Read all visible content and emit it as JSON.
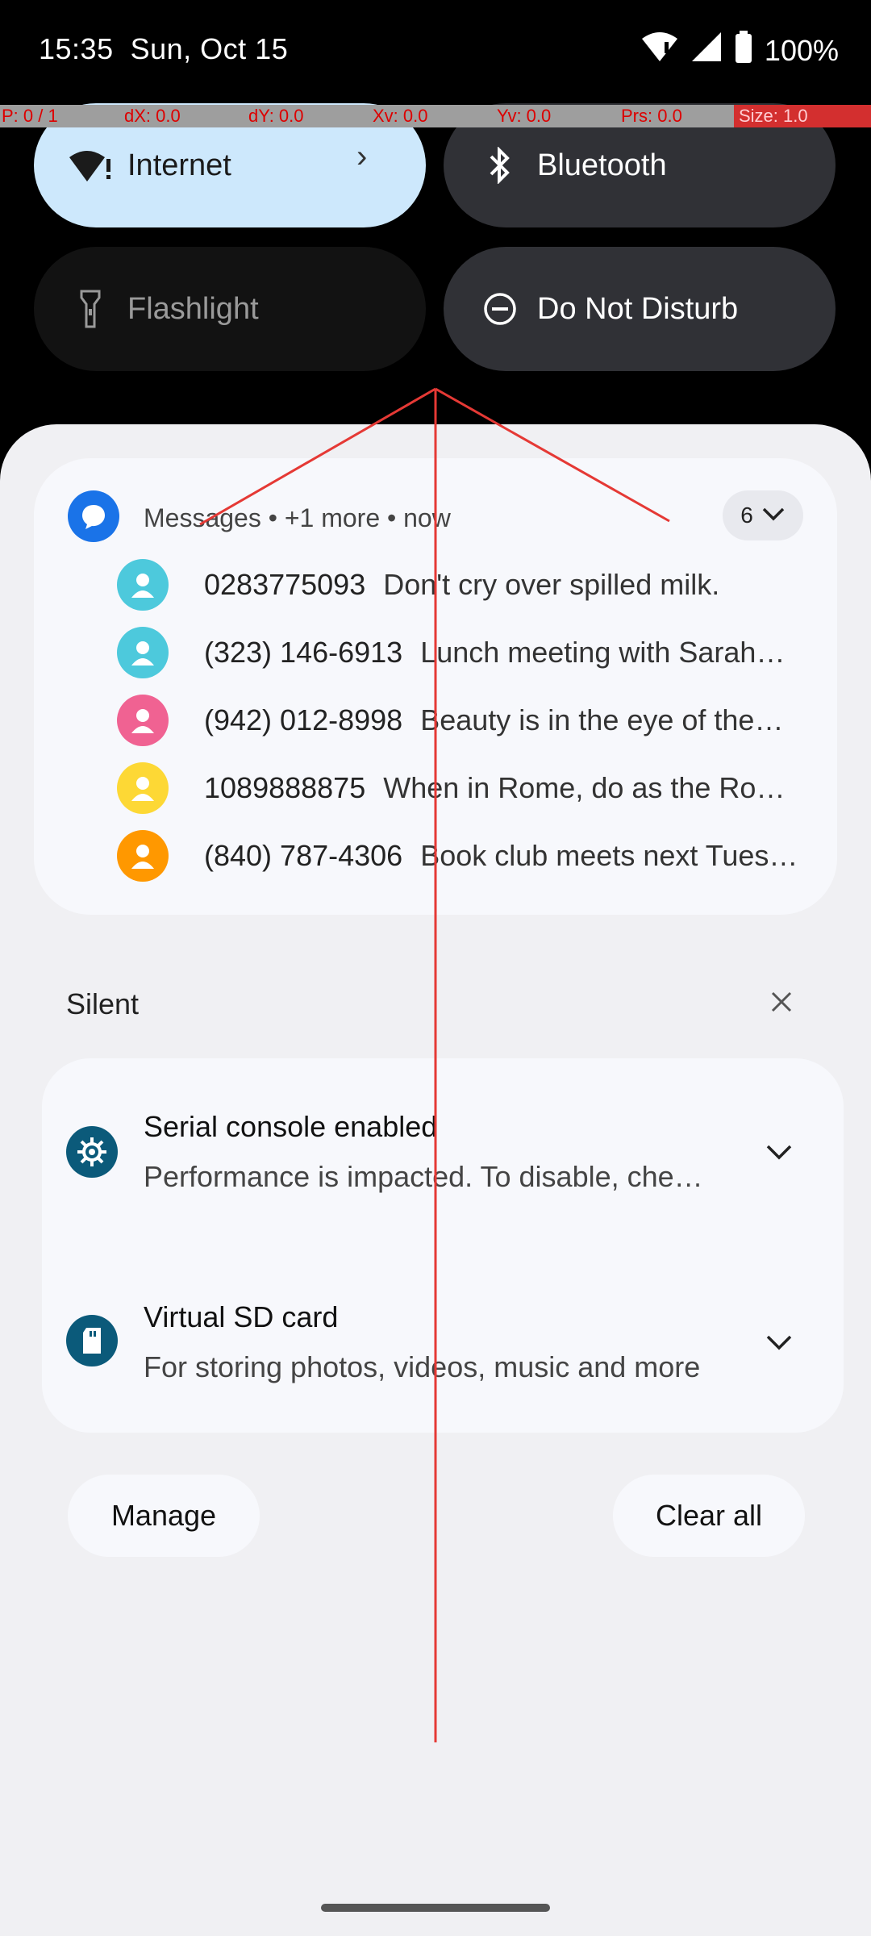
{
  "status": {
    "time": "15:35",
    "date": "Sun, Oct 15",
    "battery": "100%"
  },
  "debug": {
    "p": "P: 0 / 1",
    "dx": "dX: 0.0",
    "dy": "dY: 0.0",
    "xv": "Xv: 0.0",
    "yv": "Yv: 0.0",
    "prs": "Prs: 0.0",
    "size": "Size: 1.0"
  },
  "tiles": {
    "internet": "Internet",
    "bluetooth": "Bluetooth",
    "flashlight": "Flashlight",
    "dnd": "Do Not Disturb"
  },
  "messages": {
    "header": "Messages • +1 more • now",
    "count": "6",
    "rows": [
      {
        "number": "0283775093",
        "text": "Don't cry over spilled milk.",
        "color": "#4dc9dc"
      },
      {
        "number": "(323) 146-6913",
        "text": "Lunch meeting with Sarah…",
        "color": "#4dc9dc"
      },
      {
        "number": "(942) 012-8998",
        "text": "Beauty is in the eye of the…",
        "color": "#f06292"
      },
      {
        "number": "1089888875",
        "text": "When in Rome, do as the Ro…",
        "color": "#fdd835"
      },
      {
        "number": "(840) 787-4306",
        "text": "Book club meets next Tues…",
        "color": "#ff9800"
      }
    ]
  },
  "silent": {
    "label": "Silent"
  },
  "notifications": [
    {
      "title": "Serial console enabled",
      "body": "Performance is impacted. To disable, che…"
    },
    {
      "title": "Virtual SD card",
      "body": "For storing photos, videos, music and more"
    }
  ],
  "actions": {
    "manage": "Manage",
    "clear_all": "Clear all"
  },
  "colors": {
    "internet_tile": "#cde8fc",
    "dark_tile": "#303136",
    "flashlight_tile": "#121212",
    "notif_icon": "#0b5a7a"
  }
}
